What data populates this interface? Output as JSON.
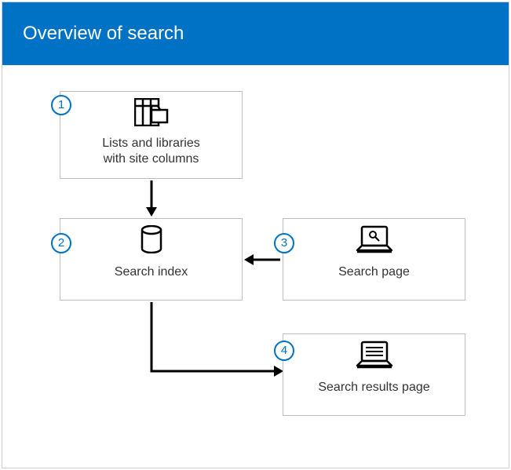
{
  "header": {
    "title": "Overview of search"
  },
  "boxes": {
    "box1": {
      "badge": "1",
      "line1": "Lists and libraries",
      "line2": "with site columns"
    },
    "box2": {
      "badge": "2",
      "label": "Search index"
    },
    "box3": {
      "badge": "3",
      "label": "Search page"
    },
    "box4": {
      "badge": "4",
      "label": "Search results page"
    }
  },
  "colors": {
    "accent": "#0072C6"
  }
}
